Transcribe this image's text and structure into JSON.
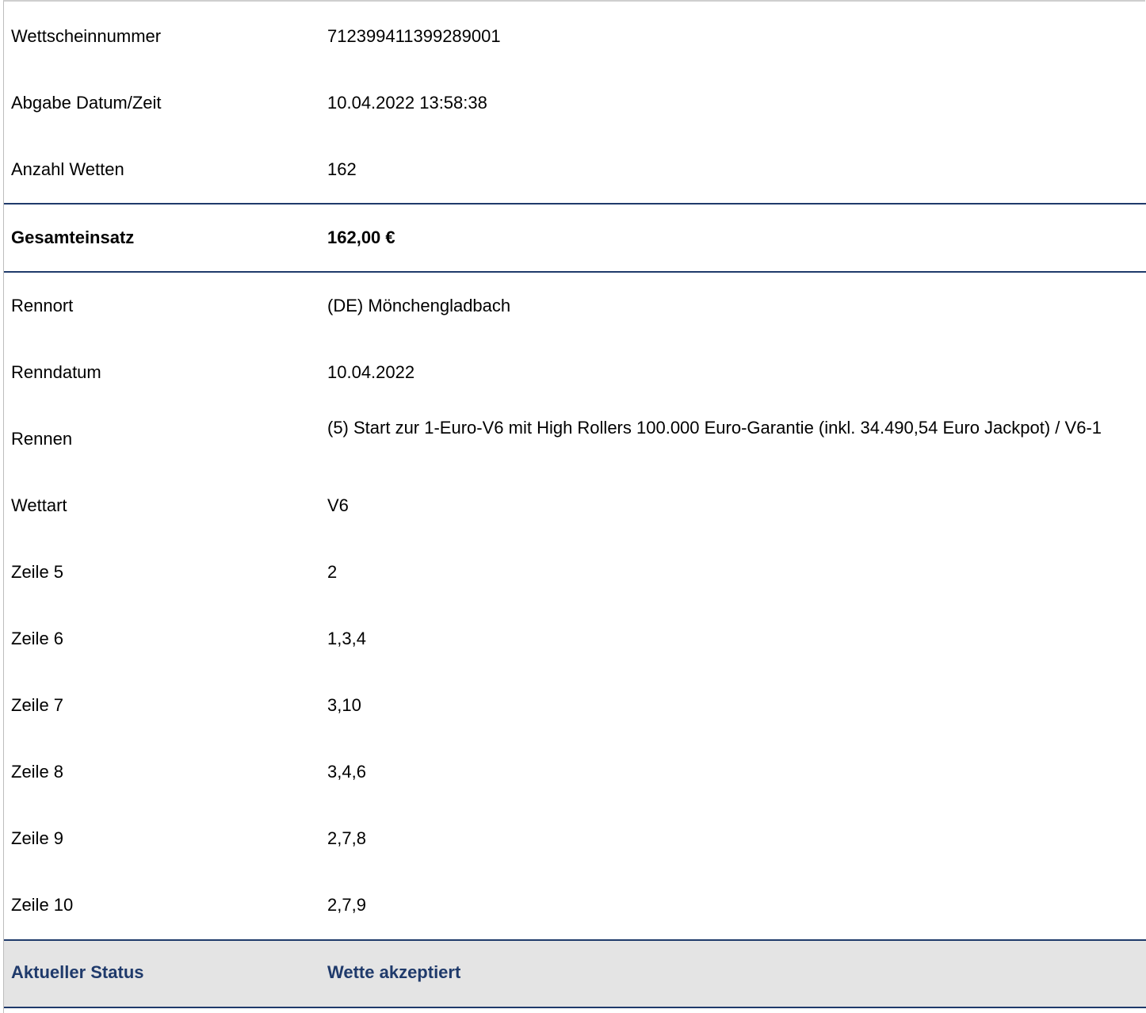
{
  "ticket": {
    "rows_top": [
      {
        "label": "Wettscheinnummer",
        "value": "712399411399289001"
      },
      {
        "label": "Abgabe Datum/Zeit",
        "value": "10.04.2022 13:58:38"
      },
      {
        "label": "Anzahl Wetten",
        "value": "162"
      }
    ],
    "total": {
      "label": "Gesamteinsatz",
      "value": "162,00 €"
    },
    "rows_detail": [
      {
        "label": "Rennort",
        "value": "(DE) Mönchengladbach"
      },
      {
        "label": "Renndatum",
        "value": "10.04.2022"
      },
      {
        "label": "Rennen",
        "value": "(5) Start zur 1-Euro-V6 mit High Rollers 100.000 Euro-Garantie (inkl. 34.490,54 Euro Jackpot) / V6-1"
      },
      {
        "label": "Wettart",
        "value": "V6"
      },
      {
        "label": "Zeile 5",
        "value": "2"
      },
      {
        "label": "Zeile 6",
        "value": "1,3,4"
      },
      {
        "label": "Zeile 7",
        "value": "3,10"
      },
      {
        "label": "Zeile 8",
        "value": "3,4,6"
      },
      {
        "label": "Zeile 9",
        "value": "2,7,8"
      },
      {
        "label": "Zeile 10",
        "value": "2,7,9"
      }
    ],
    "status": {
      "label": "Aktueller Status",
      "value": "Wette akzeptiert"
    }
  },
  "colors": {
    "accent": "#1f3a6b",
    "status_background": "#e4e4e4"
  }
}
